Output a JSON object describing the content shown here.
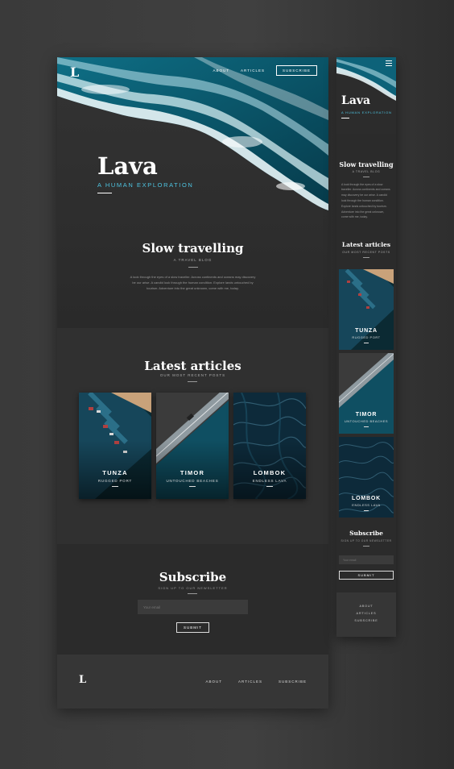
{
  "brand": {
    "logo": "L",
    "title": "Lava",
    "tagline": "A HUMAN EXPLORATION"
  },
  "nav": {
    "about": "ABOUT",
    "articles": "ARTICLES",
    "subscribe": "SUBSCRIBE"
  },
  "intro": {
    "heading": "Slow travelling",
    "subheading": "A TRAVEL BLOG",
    "body": "A look through the eyes of a slow traveller. Across continents and oceans may discovery be our arise. A candid look through the human condition. Explore lands untouched by tourism. Adventure into the great unknown, come with me, today."
  },
  "articles": {
    "heading": "Latest articles",
    "subheading": "OUR MOST RECENT POSTS",
    "items": [
      {
        "title": "TUNZA",
        "subtitle": "RUGGED PORT"
      },
      {
        "title": "TIMOR",
        "subtitle": "UNTOUCHED BEACHES"
      },
      {
        "title": "LOMBOK",
        "subtitle": "ENDLESS LAVA"
      }
    ]
  },
  "subscribe": {
    "heading": "Subscribe",
    "subheading": "SIGN UP TO OUR NEWSLETTER",
    "email_placeholder": "Your email",
    "button_label": "SUBMIT"
  },
  "footer": {
    "logo": "L",
    "about": "ABOUT",
    "articles": "ARTICLES",
    "subscribe": "SUBSCRIBE"
  },
  "colors": {
    "accent": "#4ec3e0",
    "background": "#2b2b2b",
    "section_alt": "#303030",
    "footer": "#363636"
  }
}
